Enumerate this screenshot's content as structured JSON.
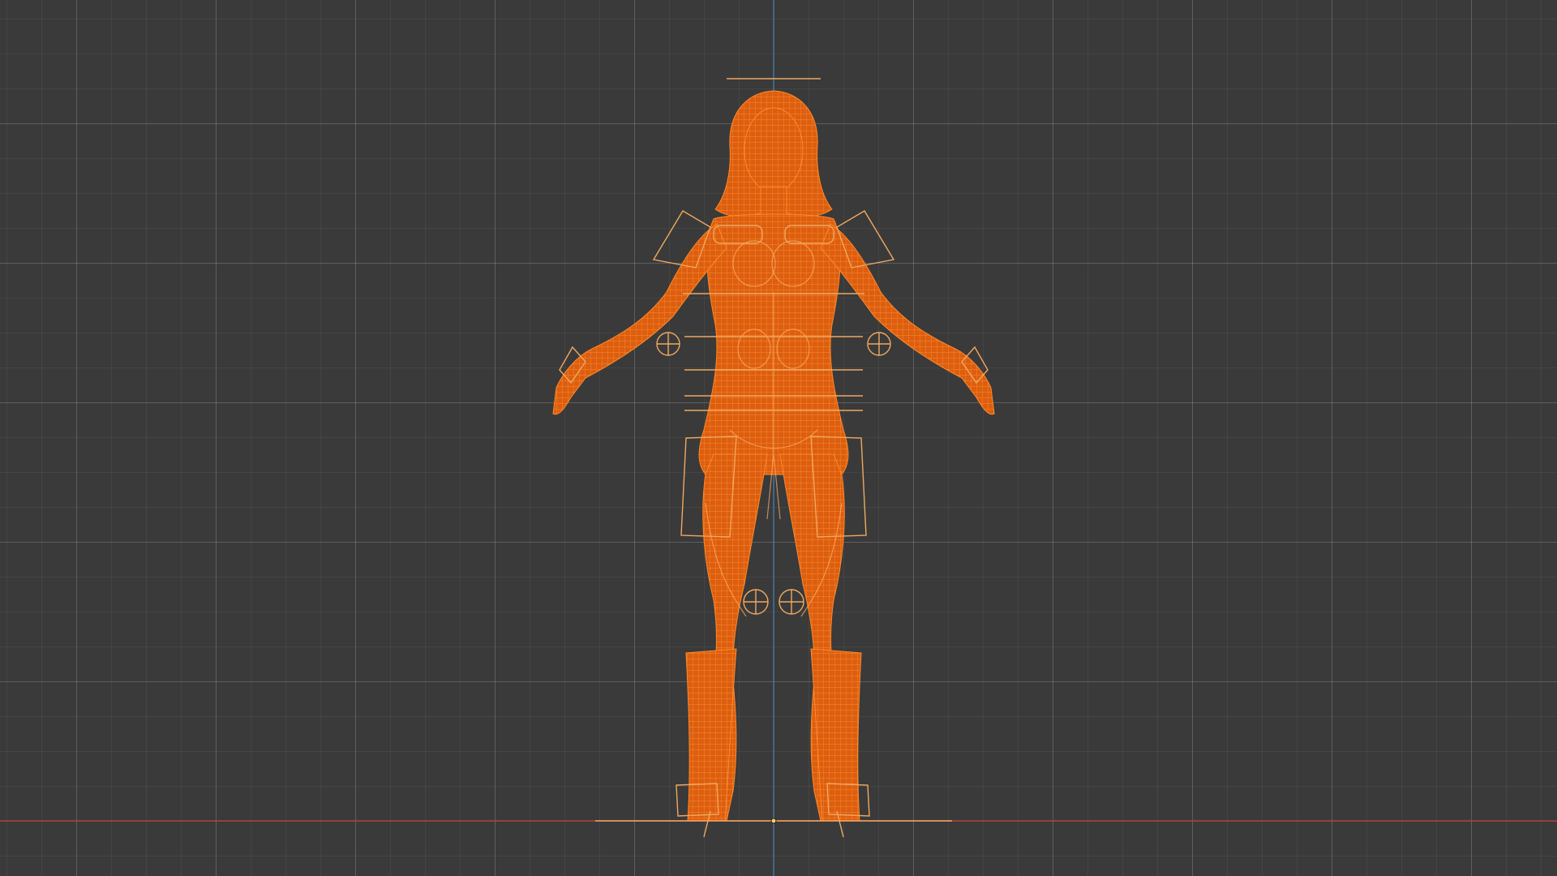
{
  "viewport": {
    "view": "front-orthographic",
    "background": "#3a3a3a",
    "grid_visible": true
  },
  "colors": {
    "selected_mesh": "#e06010",
    "wire": "#ff8a2a",
    "bone_outline": "#f0a860",
    "x_axis": "#b03a3a",
    "z_axis": "#3d6f9c"
  },
  "icons": {
    "ik_target": "circle-cross-icon",
    "origin": "origin-dot-icon"
  }
}
